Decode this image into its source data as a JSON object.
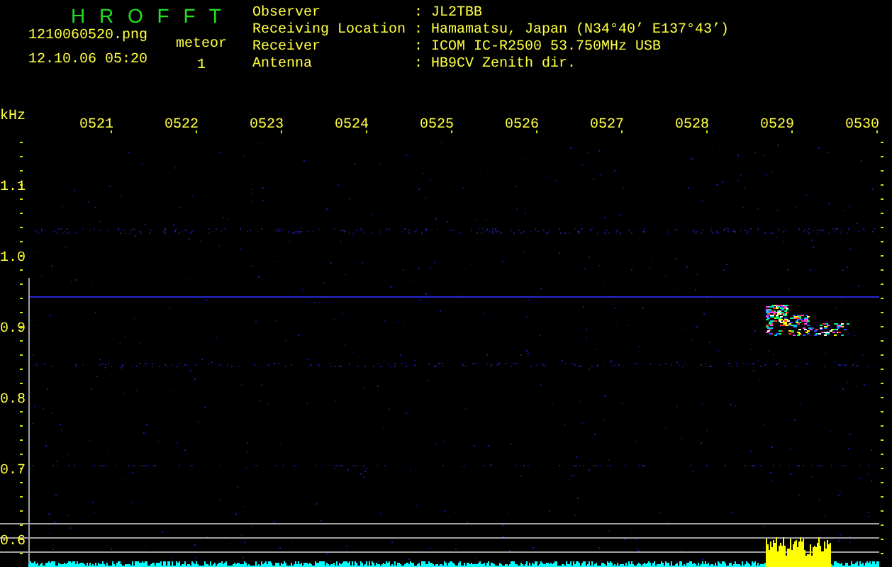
{
  "app": {
    "title": "H R O F F T",
    "file_name": "1210060520.png",
    "timestamp": "12.10.06 05:20",
    "count_label": "meteor",
    "count": "1"
  },
  "station": [
    {
      "label": "Observer",
      "value": ": JL2TBB"
    },
    {
      "label": "Receiving Location",
      "value": ": Hamamatsu, Japan (N34°40’ E137°43’)"
    },
    {
      "label": "Receiver",
      "value": ": ICOM IC-R2500 53.750MHz USB"
    },
    {
      "label": "Antenna",
      "value": ": HB9CV Zenith dir."
    }
  ],
  "spectrogram": {
    "unit": "kHz",
    "time_labels": [
      "0521",
      "0522",
      "0523",
      "0524",
      "0525",
      "0526",
      "0527",
      "0528",
      "0529",
      "0530"
    ],
    "frequency_labels": [
      "1.1",
      "1.0",
      "0.9",
      "0.8",
      "0.7",
      "0.6"
    ]
  }
}
